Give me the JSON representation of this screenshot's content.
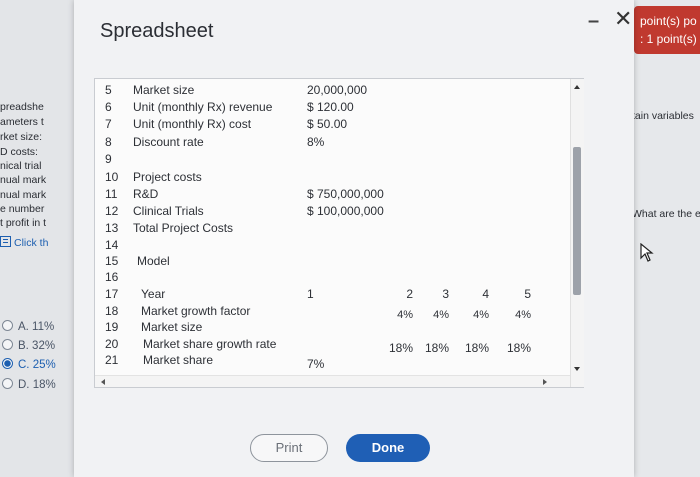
{
  "background_left": {
    "fragments": [
      "preadshe",
      "ameters t",
      "rket size:",
      "D costs: ",
      "nical trial",
      "nual mark",
      "nual mark",
      "e number",
      "t profit in t"
    ],
    "link_text": "Click th",
    "options": [
      {
        "label": "A.  11%",
        "selected": false
      },
      {
        "label": "B.  32%",
        "selected": false
      },
      {
        "label": "C.  25%",
        "selected": true
      },
      {
        "label": "D.  18%",
        "selected": false
      }
    ]
  },
  "background_right": {
    "score_line1": "point(s) po",
    "score_line2": ": 1 point(s)",
    "text1": "tain variables",
    "text2": "What are the e"
  },
  "dialog": {
    "title": "Spreadsheet",
    "minimize_glyph": "–",
    "close_glyph": "✕",
    "print_label": "Print",
    "done_label": "Done"
  },
  "sheet": {
    "rows": [
      {
        "n": "5",
        "a": "Market size",
        "b": "20,000,000"
      },
      {
        "n": "6",
        "a": "Unit (monthly Rx) revenue",
        "b": "$ 120.00"
      },
      {
        "n": "7",
        "a": "Unit (monthly Rx) cost",
        "b": "$ 50.00"
      },
      {
        "n": "8",
        "a": "Discount rate",
        "b": "8%"
      },
      {
        "n": "9",
        "a": "",
        "b": ""
      },
      {
        "n": "10",
        "a": "Project costs",
        "b": ""
      },
      {
        "n": "11",
        "a": "R&D",
        "b": "$ 750,000,000"
      },
      {
        "n": "12",
        "a": "Clinical Trials",
        "b": "$ 100,000,000"
      },
      {
        "n": "13",
        "a": "Total Project Costs",
        "b": ""
      },
      {
        "n": "14",
        "a": "",
        "b": ""
      },
      {
        "n": "15",
        "a": "Model",
        "b": ""
      },
      {
        "n": "16",
        "a": "",
        "b": ""
      },
      {
        "n": "17",
        "a": "Year",
        "b": "1",
        "c": "2",
        "d": "3",
        "e": "4",
        "f": "5"
      },
      {
        "n": "18",
        "a": "Market growth factor",
        "b": "",
        "c": "4%",
        "d": "4%",
        "e": "4%",
        "f": "4%"
      },
      {
        "n": "19",
        "a": "Market size",
        "b": ""
      },
      {
        "n": "20",
        "a": "Market share growth rate",
        "b": "",
        "c": "18%",
        "d": "18%",
        "e": "18%",
        "f": "18%"
      },
      {
        "n": "21",
        "a": "Market share",
        "b": "7%"
      }
    ]
  }
}
